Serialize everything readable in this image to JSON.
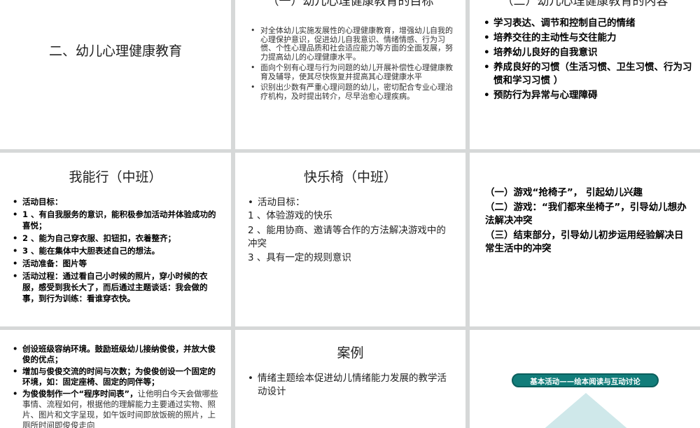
{
  "slides": {
    "s1": {
      "title": "二、幼儿心理健康教育"
    },
    "s2": {
      "title": "（一）幼儿心理健康教育的目标",
      "items": [
        "对全体幼儿实施发展性的心理健康教育，增强幼儿自我的心理保护意识，促进幼儿自我意识、情绪情感、行为习惯、个性心理品质和社会适应能力等方面的全面发展，努力提高幼儿的心理健康水平。",
        "面向个别有心理与行为问题的幼儿开展补偿性心理健康教育及辅导，使其尽快恢复并提高其心理健康水平",
        "识别出少数有严重心理问题的幼儿，密切配合专业心理治疗机构，及时提出转介，尽早治愈心理疾病。"
      ]
    },
    "s3": {
      "title": "（二）幼儿心理健康教育的内容",
      "items": [
        "学习表达、调节和控制自己的情绪",
        "培养交往的主动性与交往能力",
        "培养幼儿良好的自我意识",
        "养成良好的习惯（生活习惯、卫生习惯、行为习惯和学习习惯 ）",
        "预防行为异常与心理障碍"
      ]
    },
    "s4": {
      "title": "我能行（中班）",
      "items": [
        "活动目标：",
        "1 、有自我服务的意识，能积极参加活动并体验成功的喜悦；",
        "2 、能为自己穿衣服、扣钮扣，衣着整齐；",
        "3 、能在集体中大胆表述自己的想法。",
        "活动准备：图片等",
        "活动过程：通过看自己小时候的照片，穿小时候的衣服，感受到我长大了，而后通过主题谈话：我会做的事，到行为训练：看谁穿衣快。"
      ]
    },
    "s5": {
      "title": "快乐椅（中班）",
      "items": [
        "活动目标："
      ],
      "lines": [
        "1 、体验游戏的快乐",
        "2 、能用协商、邀请等合作的方法解决游戏中的冲突",
        "3 、具有一定的规则意识"
      ]
    },
    "s6": {
      "paras": [
        "（一）游戏“抢椅子”， 引起幼儿兴趣",
        "（二）游戏：“我们都来坐椅子”，引导幼儿想办法解决冲突",
        "（三）结束部分，引导幼儿初步运用经验解决日常生活中的冲突"
      ]
    },
    "s7": {
      "items": [
        "创设班级容纳环境。鼓励班级幼儿接纳俊俊，并放大俊俊的优点；",
        "增加与俊俊交流的时间与次数；为俊俊创设一个固定的环境，如：固定座椅、固定的同伴等；"
      ],
      "last_bold": "为俊俊制作一个“程序时间表”，",
      "last_norm": "让他明白今天会做哪些事情、流程如何，根据他的理解能力主要通过实物、照片、图片和文字呈现，如午饭时间即放饭碗的照片，上厕所时间即俊俊走向"
    },
    "s8": {
      "title": "案例",
      "items": [
        "情绪主题绘本促进幼儿情绪能力发展的教学活动设计"
      ]
    },
    "s9": {
      "banner": "基本活动——绘本阅读与互动讨论"
    }
  }
}
